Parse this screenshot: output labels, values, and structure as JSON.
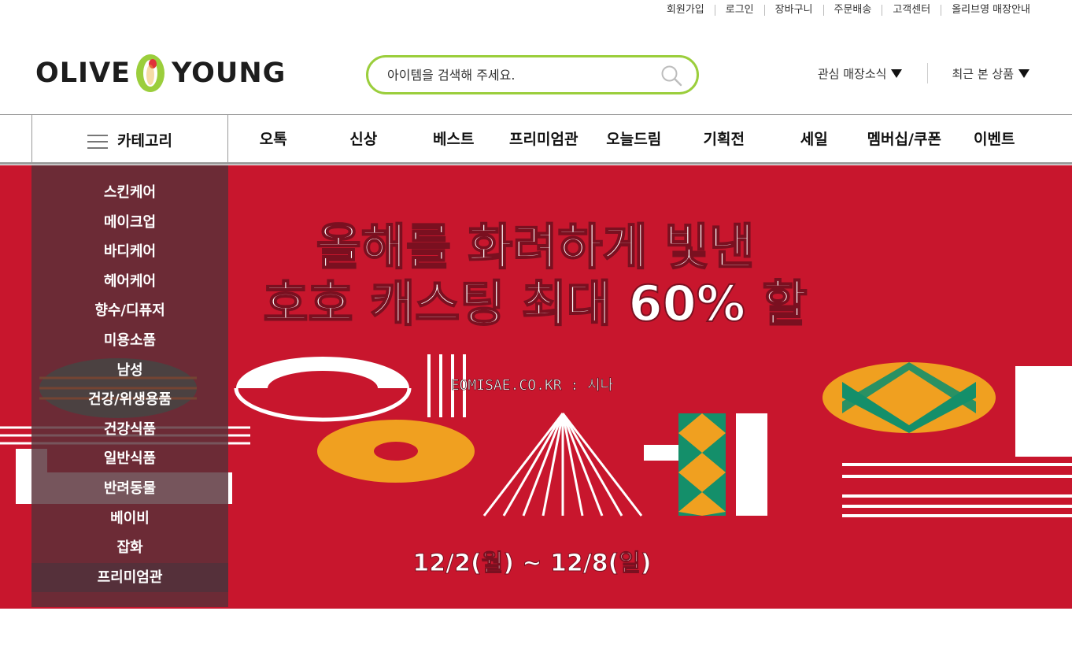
{
  "util_links": [
    "회원가입",
    "로그인",
    "장바구니",
    "주문배송",
    "고객센터",
    "올리브영 매장안내"
  ],
  "logo": {
    "left": "OLIVE",
    "right": "YOUNG",
    "accent": "#9bce3c",
    "mark_color": "#e8b03a"
  },
  "search": {
    "placeholder": "아이템을 검색해 주세요.",
    "icon": "search-icon"
  },
  "header_links": {
    "store_news": "관심 매장소식",
    "recent": "최근 본 상품"
  },
  "gnb": {
    "category_label": "카테고리",
    "menu": [
      "오톡",
      "신상",
      "베스트",
      "프리미엄관",
      "오늘드림",
      "기획전",
      "세일",
      "멤버십/쿠폰",
      "이벤트"
    ]
  },
  "categories": [
    "스킨케어",
    "메이크업",
    "바디케어",
    "헤어케어",
    "향수/디퓨저",
    "미용소품",
    "남성",
    "건강/위생용품",
    "건강식품",
    "일반식품",
    "반려동물",
    "베이비",
    "잡화",
    "프리미엄관"
  ],
  "banner": {
    "line1": "올해를 화려하게 빛낸",
    "line2": "호호 캐스팅 최대 60% 할",
    "watermark": "EOMISAE.CO.KR : 시나",
    "dates": "12/2(월) ~ 12/8(일)",
    "background": "#c8162d"
  }
}
